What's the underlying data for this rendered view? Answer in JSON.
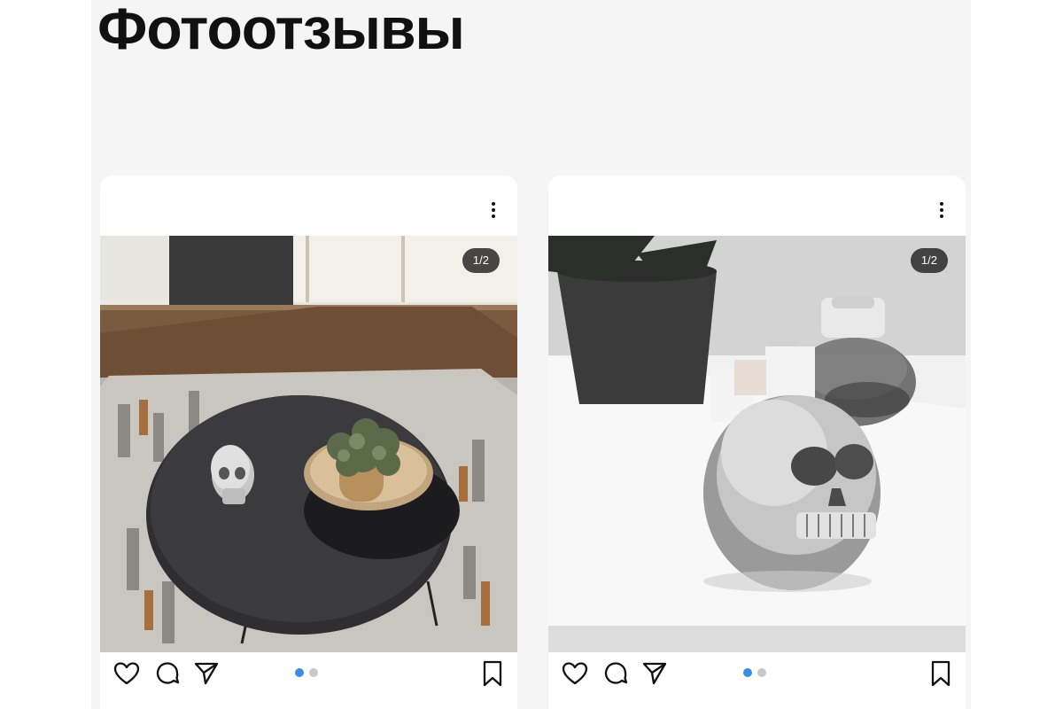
{
  "page": {
    "title": "Фотоотзывы"
  },
  "reviews": [
    {
      "counter": "1/2",
      "photo_icon": "coffee-table-skull-photo",
      "slide_count": 2,
      "active_slide": 1,
      "actions": [
        "heart-icon",
        "comment-icon",
        "share-icon",
        "bookmark-icon"
      ]
    },
    {
      "counter": "1/2",
      "photo_icon": "skull-planter-photo",
      "slide_count": 2,
      "active_slide": 1,
      "actions": [
        "heart-icon",
        "comment-icon",
        "share-icon",
        "bookmark-icon"
      ]
    }
  ],
  "colors": {
    "accent": "#3a8ee6",
    "panel_bg": "#f5f5f5",
    "card_bg": "#ffffff"
  }
}
